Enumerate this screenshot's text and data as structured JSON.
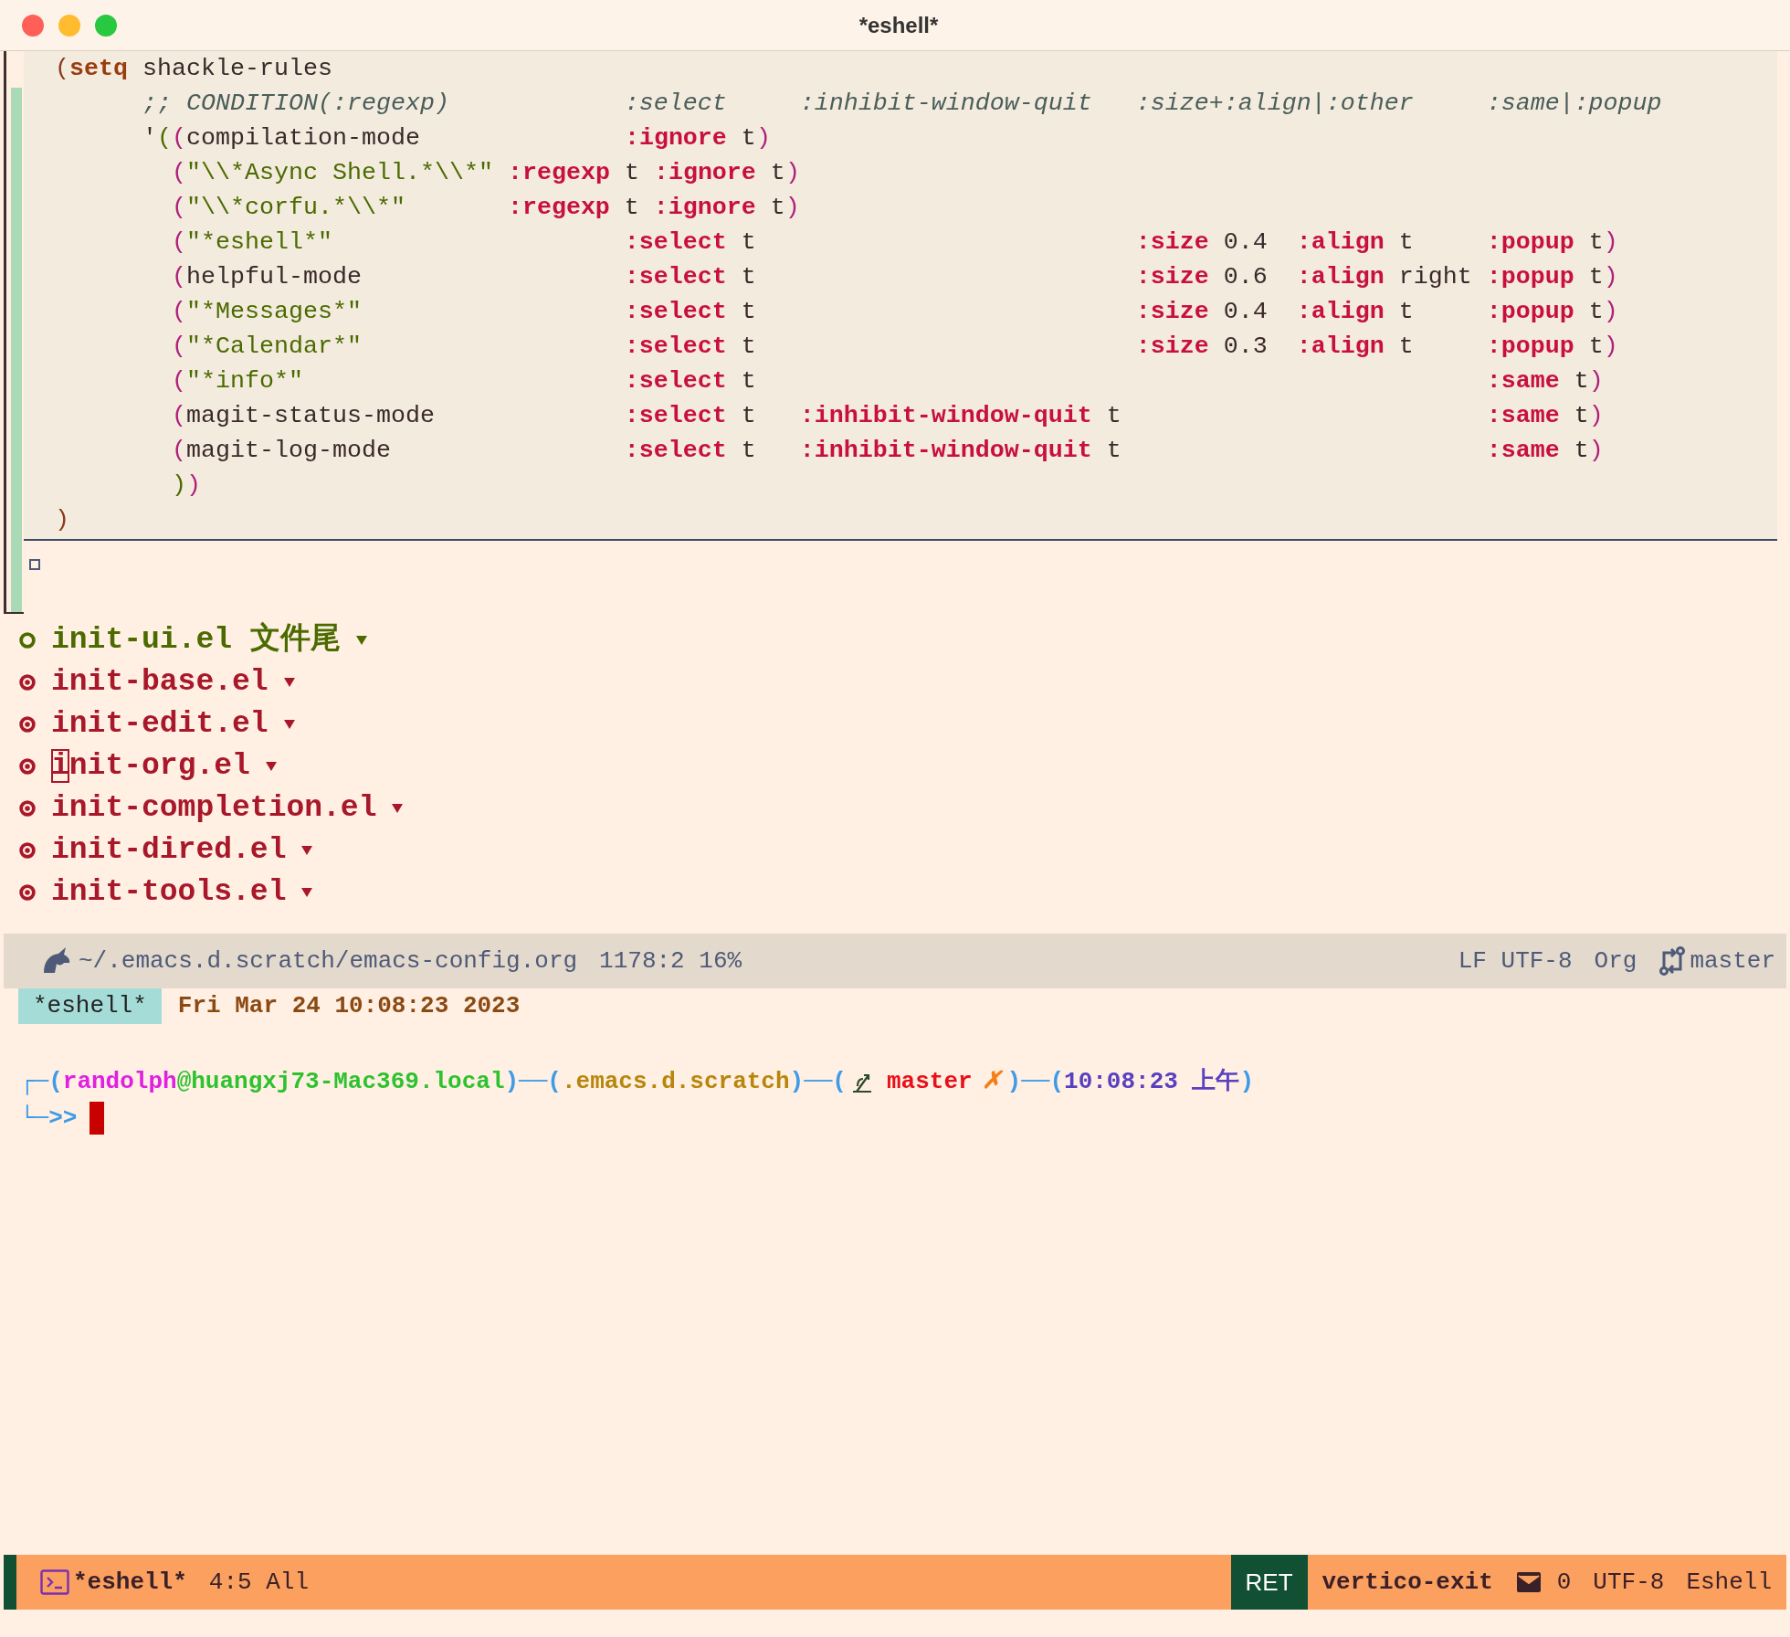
{
  "window": {
    "title": "*eshell*"
  },
  "code_block": {
    "lines": [
      [
        {
          "kind": "paren1",
          "text": "("
        },
        {
          "kind": "special",
          "text": "setq"
        },
        {
          "kind": "plain",
          "text": " shackle-rules"
        }
      ],
      [
        {
          "kind": "comment",
          "text": "      ;; CONDITION(:regexp)            :select     :inhibit-window-quit   :size+:align|:other     :same|:popup"
        }
      ],
      [
        {
          "kind": "plain",
          "text": "      '"
        },
        {
          "kind": "paren2",
          "text": "("
        },
        {
          "kind": "paren3",
          "text": "("
        },
        {
          "kind": "plain",
          "text": "compilation-mode"
        },
        {
          "kind": "keyword",
          "text": "              :ignore"
        },
        {
          "kind": "plain",
          "text": " t"
        },
        {
          "kind": "paren3",
          "text": ")"
        }
      ],
      [
        {
          "kind": "paren3",
          "text": "        ("
        },
        {
          "kind": "string",
          "text": "\"\\\\*Async Shell.*\\\\*\""
        },
        {
          "kind": "keyword",
          "text": " :regexp"
        },
        {
          "kind": "plain",
          "text": " t"
        },
        {
          "kind": "keyword",
          "text": " :ignore"
        },
        {
          "kind": "plain",
          "text": " t"
        },
        {
          "kind": "paren3",
          "text": ")"
        }
      ],
      [
        {
          "kind": "paren3",
          "text": "        ("
        },
        {
          "kind": "string",
          "text": "\"\\\\*corfu.*\\\\*\""
        },
        {
          "kind": "keyword",
          "text": "       :regexp"
        },
        {
          "kind": "plain",
          "text": " t"
        },
        {
          "kind": "keyword",
          "text": " :ignore"
        },
        {
          "kind": "plain",
          "text": " t"
        },
        {
          "kind": "paren3",
          "text": ")"
        }
      ],
      [
        {
          "kind": "paren3",
          "text": "        ("
        },
        {
          "kind": "string",
          "text": "\"*eshell*\""
        },
        {
          "kind": "keyword",
          "text": "                    :select"
        },
        {
          "kind": "plain",
          "text": " t"
        },
        {
          "kind": "keyword",
          "text": "                          :size"
        },
        {
          "kind": "plain",
          "text": " 0.4"
        },
        {
          "kind": "keyword",
          "text": "  :align"
        },
        {
          "kind": "plain",
          "text": " t"
        },
        {
          "kind": "keyword",
          "text": "     :popup"
        },
        {
          "kind": "plain",
          "text": " t"
        },
        {
          "kind": "paren3",
          "text": ")"
        }
      ],
      [
        {
          "kind": "paren3",
          "text": "        ("
        },
        {
          "kind": "plain",
          "text": "helpful-mode"
        },
        {
          "kind": "keyword",
          "text": "                  :select"
        },
        {
          "kind": "plain",
          "text": " t"
        },
        {
          "kind": "keyword",
          "text": "                          :size"
        },
        {
          "kind": "plain",
          "text": " 0.6"
        },
        {
          "kind": "keyword",
          "text": "  :align"
        },
        {
          "kind": "plain",
          "text": " right"
        },
        {
          "kind": "keyword",
          "text": " :popup"
        },
        {
          "kind": "plain",
          "text": " t"
        },
        {
          "kind": "paren3",
          "text": ")"
        }
      ],
      [
        {
          "kind": "paren3",
          "text": "        ("
        },
        {
          "kind": "string",
          "text": "\"*Messages*\""
        },
        {
          "kind": "keyword",
          "text": "                  :select"
        },
        {
          "kind": "plain",
          "text": " t"
        },
        {
          "kind": "keyword",
          "text": "                          :size"
        },
        {
          "kind": "plain",
          "text": " 0.4"
        },
        {
          "kind": "keyword",
          "text": "  :align"
        },
        {
          "kind": "plain",
          "text": " t"
        },
        {
          "kind": "keyword",
          "text": "     :popup"
        },
        {
          "kind": "plain",
          "text": " t"
        },
        {
          "kind": "paren3",
          "text": ")"
        }
      ],
      [
        {
          "kind": "paren3",
          "text": "        ("
        },
        {
          "kind": "string",
          "text": "\"*Calendar*\""
        },
        {
          "kind": "keyword",
          "text": "                  :select"
        },
        {
          "kind": "plain",
          "text": " t"
        },
        {
          "kind": "keyword",
          "text": "                          :size"
        },
        {
          "kind": "plain",
          "text": " 0.3"
        },
        {
          "kind": "keyword",
          "text": "  :align"
        },
        {
          "kind": "plain",
          "text": " t"
        },
        {
          "kind": "keyword",
          "text": "     :popup"
        },
        {
          "kind": "plain",
          "text": " t"
        },
        {
          "kind": "paren3",
          "text": ")"
        }
      ],
      [
        {
          "kind": "paren3",
          "text": "        ("
        },
        {
          "kind": "string",
          "text": "\"*info*\""
        },
        {
          "kind": "keyword",
          "text": "                      :select"
        },
        {
          "kind": "plain",
          "text": " t"
        },
        {
          "kind": "keyword",
          "text": "                                                  :same"
        },
        {
          "kind": "plain",
          "text": " t"
        },
        {
          "kind": "paren3",
          "text": ")"
        }
      ],
      [
        {
          "kind": "paren3",
          "text": "        ("
        },
        {
          "kind": "plain",
          "text": "magit-status-mode"
        },
        {
          "kind": "keyword",
          "text": "             :select"
        },
        {
          "kind": "plain",
          "text": " t"
        },
        {
          "kind": "keyword",
          "text": "   :inhibit-window-quit"
        },
        {
          "kind": "plain",
          "text": " t"
        },
        {
          "kind": "keyword",
          "text": "                         :same"
        },
        {
          "kind": "plain",
          "text": " t"
        },
        {
          "kind": "paren3",
          "text": ")"
        }
      ],
      [
        {
          "kind": "paren3",
          "text": "        ("
        },
        {
          "kind": "plain",
          "text": "magit-log-mode"
        },
        {
          "kind": "keyword",
          "text": "                :select"
        },
        {
          "kind": "plain",
          "text": " t"
        },
        {
          "kind": "keyword",
          "text": "   :inhibit-window-quit"
        },
        {
          "kind": "plain",
          "text": " t"
        },
        {
          "kind": "keyword",
          "text": "                         :same"
        },
        {
          "kind": "plain",
          "text": " t"
        },
        {
          "kind": "paren3",
          "text": ")"
        }
      ],
      [
        {
          "kind": "paren2",
          "text": "        )"
        },
        {
          "kind": "paren3",
          "text": ")"
        }
      ],
      [
        {
          "kind": "paren1",
          "text": ")"
        }
      ]
    ]
  },
  "headings": [
    {
      "kind": "ring",
      "text": "init-ui.el 文件尾",
      "cursor": false
    },
    {
      "kind": "dot",
      "text": "init-base.el",
      "cursor": false
    },
    {
      "kind": "dot",
      "text": "init-edit.el",
      "cursor": false
    },
    {
      "kind": "dot",
      "text": "init-org.el",
      "cursor": true
    },
    {
      "kind": "dot",
      "text": "init-completion.el",
      "cursor": false
    },
    {
      "kind": "dot",
      "text": "init-dired.el",
      "cursor": false
    },
    {
      "kind": "dot",
      "text": "init-tools.el",
      "cursor": false
    }
  ],
  "mode_line": {
    "file_path": "~/.emacs.d.scratch/emacs-config.org",
    "position": "1178:2 16%",
    "encoding": "LF UTF-8",
    "major_mode": "Org",
    "branch": "master"
  },
  "header_line": {
    "buffer": "*eshell*",
    "date": "Fri Mar 24 10:08:23 2023"
  },
  "prompt": {
    "line1": [
      {
        "kind": "frame",
        "text": "┌─("
      },
      {
        "kind": "user",
        "text": "randolph"
      },
      {
        "kind": "host",
        "text": "@huangxj73-Mac369.local"
      },
      {
        "kind": "frame",
        "text": ")──("
      },
      {
        "kind": "dir",
        "text": ".emacs.d.scratch"
      },
      {
        "kind": "frame",
        "text": ")──("
      },
      {
        "kind": "icon"
      },
      {
        "kind": "branch",
        "text": "master"
      },
      {
        "kind": "dirty",
        "text": "✗"
      },
      {
        "kind": "frame",
        "text": ")──("
      },
      {
        "kind": "time",
        "text": "10:08:23 上午"
      },
      {
        "kind": "frame",
        "text": ")"
      }
    ],
    "line2": "└─>>"
  },
  "bottom_mode_line": {
    "buffer": "*eshell*",
    "position": "4:5 All",
    "key": "RET",
    "command": "vertico-exit",
    "mail_count": "0",
    "encoding": "UTF-8",
    "mode": "Eshell"
  }
}
